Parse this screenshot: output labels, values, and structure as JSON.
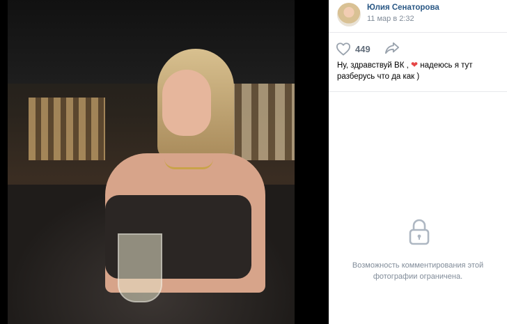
{
  "post": {
    "author": "Юлия Сенаторова",
    "date": "11 мар в 2:32",
    "likes": "449",
    "text_part1": "Ну, здравствуй ВК ,",
    "text_emoji": "❤",
    "text_part2": "надеюсь я тут разберусь что да как )"
  },
  "comments": {
    "restricted_line1": "Возможность комментирования этой",
    "restricted_line2": "фотографии ограничена."
  },
  "icons": {
    "like": "heart-icon",
    "share": "share-icon",
    "lock": "lock-icon"
  },
  "colors": {
    "link": "#2a5885",
    "muted": "#818c99",
    "icon": "#99a2ad",
    "emoji": "#e64646"
  }
}
